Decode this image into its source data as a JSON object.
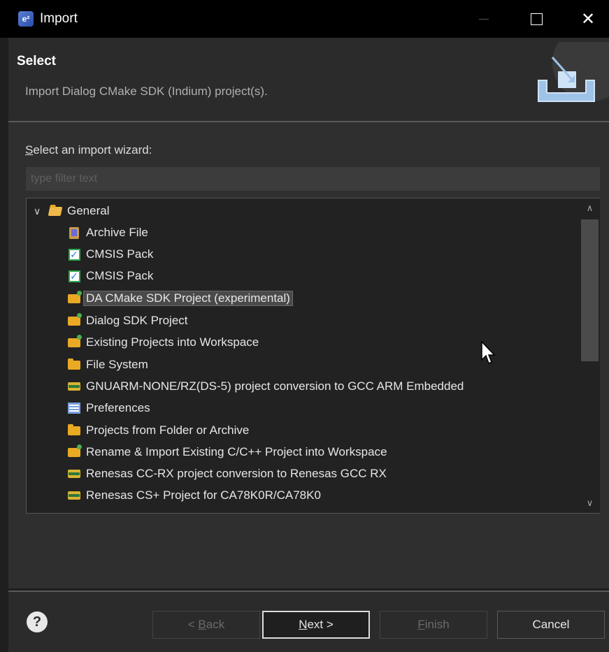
{
  "window": {
    "app_icon_glyph": "e²",
    "title": "Import",
    "close_glyph": "✕"
  },
  "header": {
    "title": "Select",
    "description": "Import Dialog CMake SDK (Indium) project(s)."
  },
  "wizard": {
    "select_label_mnemonic": "S",
    "select_label_rest": "elect an import wizard:",
    "filter_placeholder": "type filter text",
    "filter_value": ""
  },
  "tree": {
    "root": {
      "label": "General",
      "expanded": true,
      "icon": "folder-open-icon"
    },
    "items": [
      {
        "label": "Archive File",
        "icon": "archive-file-icon"
      },
      {
        "label": "CMSIS Pack",
        "icon": "cmsis-pack-icon"
      },
      {
        "label": "CMSIS Pack",
        "icon": "cmsis-pack-icon"
      },
      {
        "label": "DA CMake SDK Project (experimental)",
        "icon": "project-folder-icon",
        "selected": true
      },
      {
        "label": "Dialog SDK Project",
        "icon": "project-folder-icon"
      },
      {
        "label": "Existing Projects into Workspace",
        "icon": "project-folder-icon"
      },
      {
        "label": "File System",
        "icon": "folder-icon"
      },
      {
        "label": "GNUARM-NONE/RZ(DS-5)  project conversion to GCC ARM Embedded",
        "icon": "renesas-conversion-icon"
      },
      {
        "label": "Preferences",
        "icon": "preferences-icon"
      },
      {
        "label": "Projects from Folder or Archive",
        "icon": "folder-icon"
      },
      {
        "label": "Rename & Import Existing C/C++ Project into Workspace",
        "icon": "project-folder-icon"
      },
      {
        "label": "Renesas CC-RX project conversion to Renesas GCC RX",
        "icon": "renesas-conversion-icon"
      },
      {
        "label": "Renesas CS+ Project for CA78K0R/CA78K0",
        "icon": "renesas-conversion-icon"
      }
    ],
    "scroll_position": 0.0
  },
  "buttons": {
    "help": "?",
    "back_prefix": "< ",
    "back_mnemonic": "B",
    "back_rest": "ack",
    "next_mnemonic": "N",
    "next_rest": "ext >",
    "finish_mnemonic": "F",
    "finish_rest": "inish",
    "cancel": "Cancel",
    "back_enabled": false,
    "finish_enabled": false
  },
  "colors": {
    "selection": "#4a4a4a",
    "accent_folder": "#e9a923",
    "check_green": "#2fa84f"
  }
}
